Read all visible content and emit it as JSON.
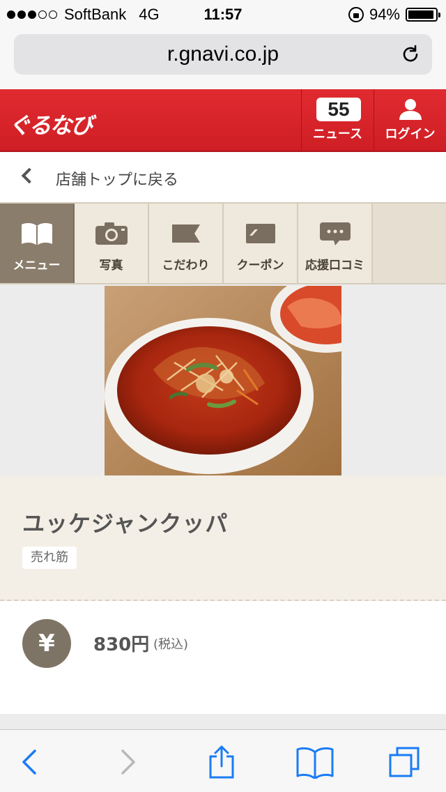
{
  "status_bar": {
    "carrier": "SoftBank",
    "network": "4G",
    "time": "11:57",
    "battery": "94%",
    "battery_level": 0.94,
    "signal_bars": 3,
    "signal_total": 5
  },
  "browser": {
    "url": "r.gnavi.co.jp"
  },
  "header": {
    "logo": "ぐるなび",
    "news_count": "55",
    "news_label": "ニュース",
    "login_label": "ログイン",
    "accent_color": "#d7232a"
  },
  "back": {
    "label": "店舗トップに戻る"
  },
  "tabs": [
    {
      "label": "メニュー",
      "icon": "book-icon",
      "active": true
    },
    {
      "label": "写真",
      "icon": "camera-icon",
      "active": false
    },
    {
      "label": "こだわり",
      "icon": "flag-icon",
      "active": false
    },
    {
      "label": "クーポン",
      "icon": "ticket-icon",
      "active": false
    },
    {
      "label": "応援口コミ",
      "icon": "chat-icon",
      "active": false
    }
  ],
  "dish": {
    "name": "ユッケジャンクッパ",
    "badge": "売れ筋",
    "currency_symbol": "¥",
    "price": "830円",
    "tax_note": "(税込)"
  }
}
